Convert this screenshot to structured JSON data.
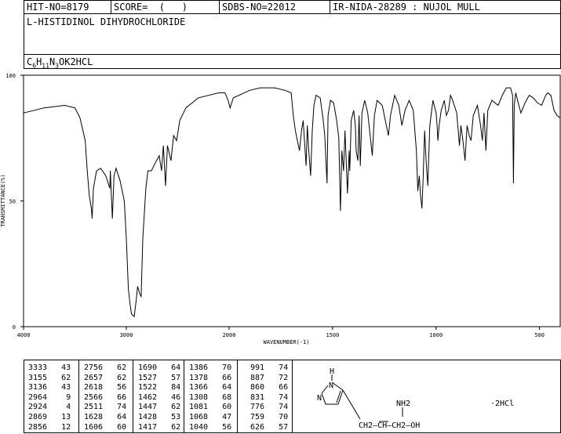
{
  "header": {
    "hit_no": "HIT-NO=8179",
    "score": "SCORE=  (   )",
    "sdbs_no": "SDBS-NO=22012",
    "ir_info": "IR-NIDA-28289 : NUJOL MULL"
  },
  "compound_name": "L-HISTIDINOL DIHYDROCHLORIDE",
  "formula": {
    "p1": "C",
    "s1": "6",
    "p2": "H",
    "s2": "11",
    "p3": "N",
    "s3": "3",
    "p4": "OK2HCL"
  },
  "chart_data": {
    "type": "line",
    "title": "",
    "xlabel": "WAVENUMBER(-1)",
    "ylabel": "TRANSMITTANCE(%)",
    "xlim": [
      4000,
      400
    ],
    "ylim": [
      0,
      100
    ],
    "x_ticks": [
      "4000",
      "3000",
      "2000",
      "1500",
      "1000",
      "500"
    ],
    "y_ticks": [
      "100",
      "50",
      "0"
    ],
    "series": [
      {
        "values": [
          [
            4000,
            85
          ],
          [
            3800,
            87
          ],
          [
            3600,
            88
          ],
          [
            3500,
            87
          ],
          [
            3450,
            83
          ],
          [
            3400,
            74
          ],
          [
            3380,
            62
          ],
          [
            3360,
            52
          ],
          [
            3340,
            47
          ],
          [
            3333,
            43
          ],
          [
            3320,
            55
          ],
          [
            3290,
            62
          ],
          [
            3250,
            63
          ],
          [
            3200,
            60
          ],
          [
            3160,
            55
          ],
          [
            3156,
            62
          ],
          [
            3136,
            43
          ],
          [
            3120,
            60
          ],
          [
            3100,
            63
          ],
          [
            3060,
            58
          ],
          [
            3020,
            50
          ],
          [
            3000,
            35
          ],
          [
            2980,
            15
          ],
          [
            2964,
            9
          ],
          [
            2950,
            5
          ],
          [
            2924,
            4
          ],
          [
            2905,
            10
          ],
          [
            2890,
            16
          ],
          [
            2869,
            13
          ],
          [
            2856,
            12
          ],
          [
            2840,
            35
          ],
          [
            2810,
            55
          ],
          [
            2790,
            62
          ],
          [
            2756,
            62
          ],
          [
            2720,
            65
          ],
          [
            2680,
            68
          ],
          [
            2657,
            62
          ],
          [
            2640,
            72
          ],
          [
            2618,
            56
          ],
          [
            2600,
            72
          ],
          [
            2566,
            66
          ],
          [
            2540,
            76
          ],
          [
            2511,
            74
          ],
          [
            2480,
            82
          ],
          [
            2420,
            87
          ],
          [
            2300,
            91
          ],
          [
            2200,
            92
          ],
          [
            2100,
            93
          ],
          [
            2040,
            93
          ],
          [
            2010,
            90
          ],
          [
            1995,
            87
          ],
          [
            1980,
            91
          ],
          [
            1900,
            94
          ],
          [
            1850,
            95
          ],
          [
            1780,
            95
          ],
          [
            1730,
            94
          ],
          [
            1700,
            93
          ],
          [
            1690,
            84
          ],
          [
            1680,
            78
          ],
          [
            1670,
            74
          ],
          [
            1660,
            70
          ],
          [
            1650,
            78
          ],
          [
            1642,
            82
          ],
          [
            1628,
            64
          ],
          [
            1622,
            80
          ],
          [
            1615,
            70
          ],
          [
            1606,
            60
          ],
          [
            1598,
            78
          ],
          [
            1590,
            88
          ],
          [
            1580,
            92
          ],
          [
            1560,
            91
          ],
          [
            1545,
            82
          ],
          [
            1538,
            76
          ],
          [
            1527,
            57
          ],
          [
            1522,
            84
          ],
          [
            1510,
            90
          ],
          [
            1495,
            89
          ],
          [
            1480,
            82
          ],
          [
            1470,
            75
          ],
          [
            1462,
            46
          ],
          [
            1455,
            70
          ],
          [
            1447,
            62
          ],
          [
            1440,
            78
          ],
          [
            1428,
            53
          ],
          [
            1420,
            70
          ],
          [
            1417,
            62
          ],
          [
            1410,
            82
          ],
          [
            1398,
            86
          ],
          [
            1390,
            80
          ],
          [
            1386,
            70
          ],
          [
            1378,
            66
          ],
          [
            1372,
            84
          ],
          [
            1366,
            64
          ],
          [
            1358,
            85
          ],
          [
            1345,
            90
          ],
          [
            1330,
            85
          ],
          [
            1308,
            68
          ],
          [
            1298,
            84
          ],
          [
            1285,
            90
          ],
          [
            1260,
            88
          ],
          [
            1240,
            80
          ],
          [
            1230,
            76
          ],
          [
            1220,
            84
          ],
          [
            1200,
            92
          ],
          [
            1180,
            88
          ],
          [
            1165,
            80
          ],
          [
            1150,
            86
          ],
          [
            1130,
            90
          ],
          [
            1110,
            86
          ],
          [
            1095,
            70
          ],
          [
            1088,
            54
          ],
          [
            1081,
            60
          ],
          [
            1075,
            52
          ],
          [
            1068,
            47
          ],
          [
            1062,
            60
          ],
          [
            1055,
            78
          ],
          [
            1048,
            66
          ],
          [
            1040,
            56
          ],
          [
            1030,
            80
          ],
          [
            1015,
            90
          ],
          [
            1000,
            85
          ],
          [
            995,
            80
          ],
          [
            991,
            74
          ],
          [
            985,
            80
          ],
          [
            975,
            86
          ],
          [
            960,
            90
          ],
          [
            950,
            84
          ],
          [
            940,
            86
          ],
          [
            930,
            92
          ],
          [
            920,
            90
          ],
          [
            900,
            85
          ],
          [
            887,
            72
          ],
          [
            880,
            80
          ],
          [
            870,
            74
          ],
          [
            860,
            66
          ],
          [
            850,
            80
          ],
          [
            840,
            76
          ],
          [
            831,
            74
          ],
          [
            820,
            84
          ],
          [
            800,
            88
          ],
          [
            785,
            80
          ],
          [
            776,
            74
          ],
          [
            768,
            85
          ],
          [
            759,
            70
          ],
          [
            750,
            86
          ],
          [
            730,
            90
          ],
          [
            700,
            88
          ],
          [
            680,
            92
          ],
          [
            660,
            95
          ],
          [
            640,
            95
          ],
          [
            630,
            92
          ],
          [
            626,
            57
          ],
          [
            622,
            88
          ],
          [
            615,
            93
          ],
          [
            600,
            88
          ],
          [
            590,
            85
          ],
          [
            570,
            89
          ],
          [
            550,
            92
          ],
          [
            530,
            91
          ],
          [
            510,
            89
          ],
          [
            490,
            88
          ],
          [
            480,
            90
          ],
          [
            470,
            92
          ],
          [
            460,
            93
          ],
          [
            445,
            92
          ],
          [
            430,
            86
          ],
          [
            415,
            84
          ],
          [
            400,
            83
          ]
        ]
      }
    ],
    "grid": false,
    "legend": "none"
  },
  "peaks": {
    "col1": [
      [
        "3333",
        "43"
      ],
      [
        "3155",
        "62"
      ],
      [
        "3136",
        "43"
      ],
      [
        "2964",
        "9"
      ],
      [
        "2924",
        "4"
      ],
      [
        "2869",
        "13"
      ],
      [
        "2856",
        "12"
      ]
    ],
    "col2": [
      [
        "2756",
        "62"
      ],
      [
        "2657",
        "62"
      ],
      [
        "2618",
        "56"
      ],
      [
        "2566",
        "66"
      ],
      [
        "2511",
        "74"
      ],
      [
        "1628",
        "64"
      ],
      [
        "1606",
        "60"
      ]
    ],
    "col3": [
      [
        "1690",
        "64"
      ],
      [
        "1527",
        "57"
      ],
      [
        "1522",
        "84"
      ],
      [
        "1462",
        "46"
      ],
      [
        "1447",
        "62"
      ],
      [
        "1428",
        "53"
      ],
      [
        "1417",
        "62"
      ]
    ],
    "col4": [
      [
        "1386",
        "70"
      ],
      [
        "1378",
        "66"
      ],
      [
        "1366",
        "64"
      ],
      [
        "1308",
        "68"
      ],
      [
        "1081",
        "60"
      ],
      [
        "1068",
        "47"
      ],
      [
        "1040",
        "56"
      ]
    ],
    "col5": [
      [
        "991",
        "74"
      ],
      [
        "887",
        "72"
      ],
      [
        "860",
        "66"
      ],
      [
        "831",
        "74"
      ],
      [
        "776",
        "74"
      ],
      [
        "759",
        "70"
      ],
      [
        "626",
        "57"
      ]
    ]
  },
  "structure": {
    "h_label": "H",
    "n1_label": "N",
    "n2_label": "N",
    "nh2_label": "NH2",
    "chain": "CH2—CH—CH2—OH",
    "salt": "·2HCl"
  }
}
